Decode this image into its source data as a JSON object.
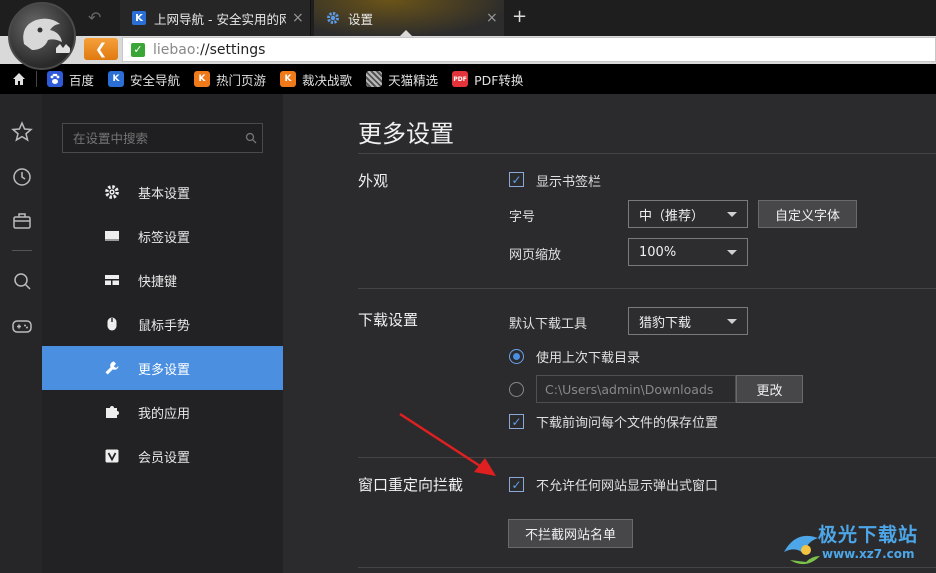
{
  "tabs": [
    {
      "label": "上网导航 - 安全实用的网址导航",
      "icon": "liebao-k-icon",
      "close": "×"
    },
    {
      "label": "设置",
      "icon": "gear-icon",
      "close": "×"
    }
  ],
  "new_tab": "+",
  "address": {
    "scheme": "liebao:",
    "path": "//settings"
  },
  "bookmarks": [
    {
      "label": "百度",
      "icon": "baidu-paw-icon",
      "color": "#2f5bd9"
    },
    {
      "label": "安全导航",
      "icon": "liebao-k-icon",
      "color": "#2b6fd6"
    },
    {
      "label": "热门页游",
      "icon": "liebao-k-icon",
      "color": "#f07a1a"
    },
    {
      "label": "裁决战歌",
      "icon": "liebao-k-icon",
      "color": "#f07a1a"
    },
    {
      "label": "天猫精选",
      "icon": "qr-grid-icon",
      "color": "#888888"
    },
    {
      "label": "PDF转换",
      "icon": "pdf-icon",
      "color": "#e2343a",
      "icon_text": "PDF"
    }
  ],
  "search": {
    "placeholder": "在设置中搜索"
  },
  "nav": [
    {
      "label": "基本设置",
      "icon": "gear-icon"
    },
    {
      "label": "标签设置",
      "icon": "tab-icon"
    },
    {
      "label": "快捷键",
      "icon": "keyboard-icon"
    },
    {
      "label": "鼠标手势",
      "icon": "mouse-icon"
    },
    {
      "label": "更多设置",
      "icon": "wrench-icon",
      "active": true
    },
    {
      "label": "我的应用",
      "icon": "puzzle-icon"
    },
    {
      "label": "会员设置",
      "icon": "vip-v-icon"
    }
  ],
  "page_title": "更多设置",
  "appearance": {
    "title": "外观",
    "show_bookmarks_label": "显示书签栏",
    "show_bookmarks_checked": true,
    "font_size_label": "字号",
    "font_size_value": "中（推荐）",
    "custom_font_button": "自定义字体",
    "zoom_label": "网页缩放",
    "zoom_value": "100%"
  },
  "download": {
    "title": "下载设置",
    "tool_label": "默认下载工具",
    "tool_value": "猎豹下载",
    "use_last_dir_label": "使用上次下载目录",
    "use_last_dir_selected": true,
    "path_value": "C:\\Users\\admin\\Downloads",
    "change_button": "更改",
    "ask_location_label": "下载前询问每个文件的保存位置",
    "ask_location_checked": true
  },
  "redirect": {
    "title": "窗口重定向拦截",
    "block_popup_label": "不允许任何网站显示弹出式窗口",
    "block_popup_checked": true,
    "whitelist_button": "不拦截网站名单"
  },
  "watermark": {
    "title": "极光下载站",
    "url": "www.xz7.com"
  },
  "colors": {
    "accent": "#4a8fe0",
    "annotation_arrow": "#e02020",
    "back_button": "#f08a1e"
  }
}
